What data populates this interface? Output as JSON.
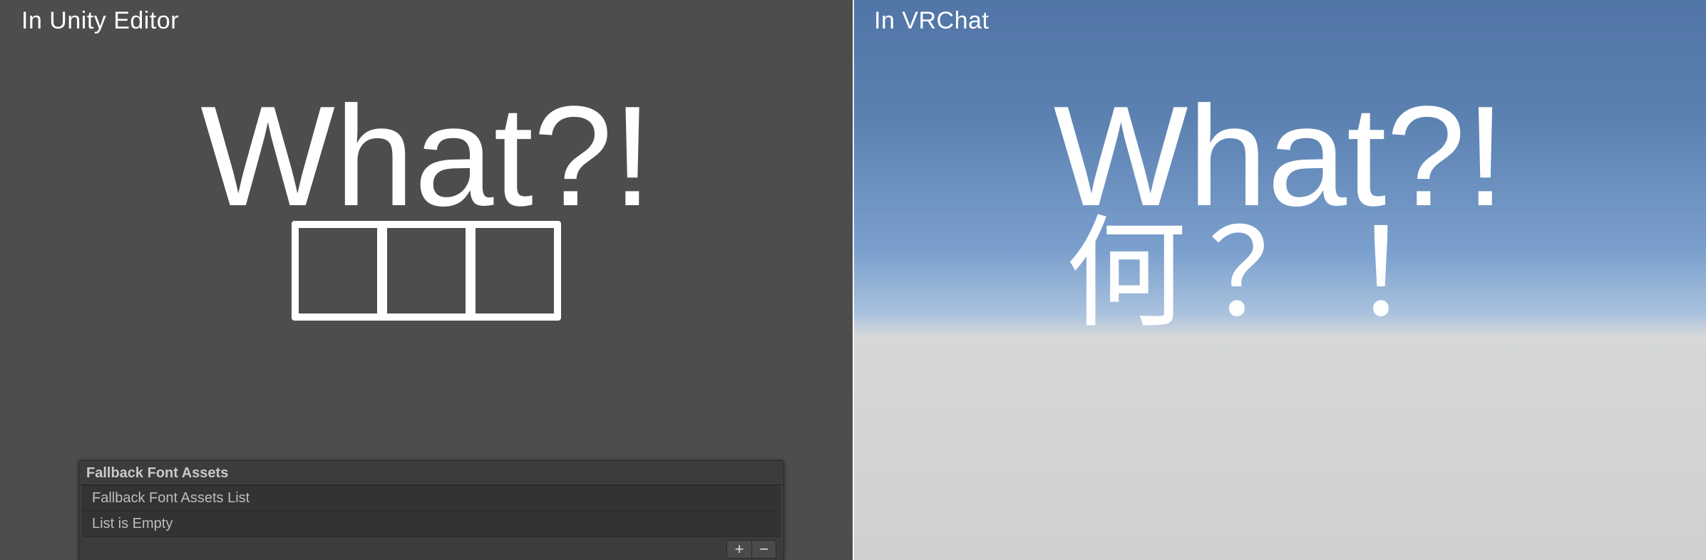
{
  "left": {
    "label": "In Unity Editor",
    "line1": "What?!",
    "tofu_count": 3,
    "inspector": {
      "title": "Fallback Font Assets",
      "list_title": "Fallback Font Assets List",
      "empty_text": "List is Empty",
      "add_label": "+",
      "remove_label": "−"
    }
  },
  "right": {
    "label": "In VRChat",
    "line1": "What?!",
    "line2": "何？！"
  },
  "colors": {
    "left_bg": "#4d4d4d",
    "text": "#ffffff",
    "inspector_bg": "#3c3c3c",
    "inspector_row_bg": "#333333"
  }
}
